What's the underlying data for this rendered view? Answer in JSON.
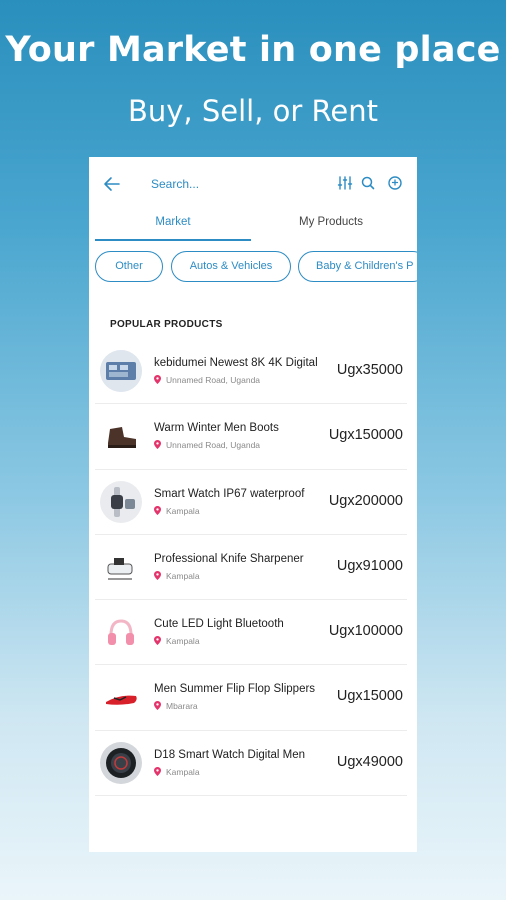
{
  "header": {
    "title": "Your Market in one place",
    "subtitle": "Buy, Sell, or Rent"
  },
  "search": {
    "placeholder": "Search..."
  },
  "colors": {
    "accent": "#2d8cc4",
    "pin": "#e5336b"
  },
  "tabs": [
    {
      "label": "Market",
      "active": true
    },
    {
      "label": "My Products",
      "active": false
    }
  ],
  "categories": [
    {
      "label": "Other"
    },
    {
      "label": "Autos & Vehicles"
    },
    {
      "label": "Baby & Children's P"
    }
  ],
  "section_title": "POPULAR PRODUCTS",
  "products": [
    {
      "name": "kebidumei Newest 8K 4K Digital",
      "location": "Unnamed Road, Uganda",
      "price": "Ugx35000",
      "icon": "camera-product-icon"
    },
    {
      "name": "Warm Winter Men Boots",
      "location": "Unnamed Road, Uganda",
      "price": "Ugx150000",
      "icon": "boot-product-icon"
    },
    {
      "name": "Smart Watch IP67 waterproof",
      "location": "Kampala",
      "price": "Ugx200000",
      "icon": "smartwatch-product-icon"
    },
    {
      "name": "Professional Knife Sharpener",
      "location": "Kampala",
      "price": "Ugx91000",
      "icon": "knife-sharpener-product-icon"
    },
    {
      "name": "Cute LED Light Bluetooth",
      "location": "Kampala",
      "price": "Ugx100000",
      "icon": "headphones-product-icon"
    },
    {
      "name": "Men Summer Flip Flop Slippers",
      "location": "Mbarara",
      "price": "Ugx15000",
      "icon": "slipper-product-icon"
    },
    {
      "name": "D18 Smart Watch Digital Men",
      "location": "Kampala",
      "price": "Ugx49000",
      "icon": "watch-product-icon"
    }
  ]
}
